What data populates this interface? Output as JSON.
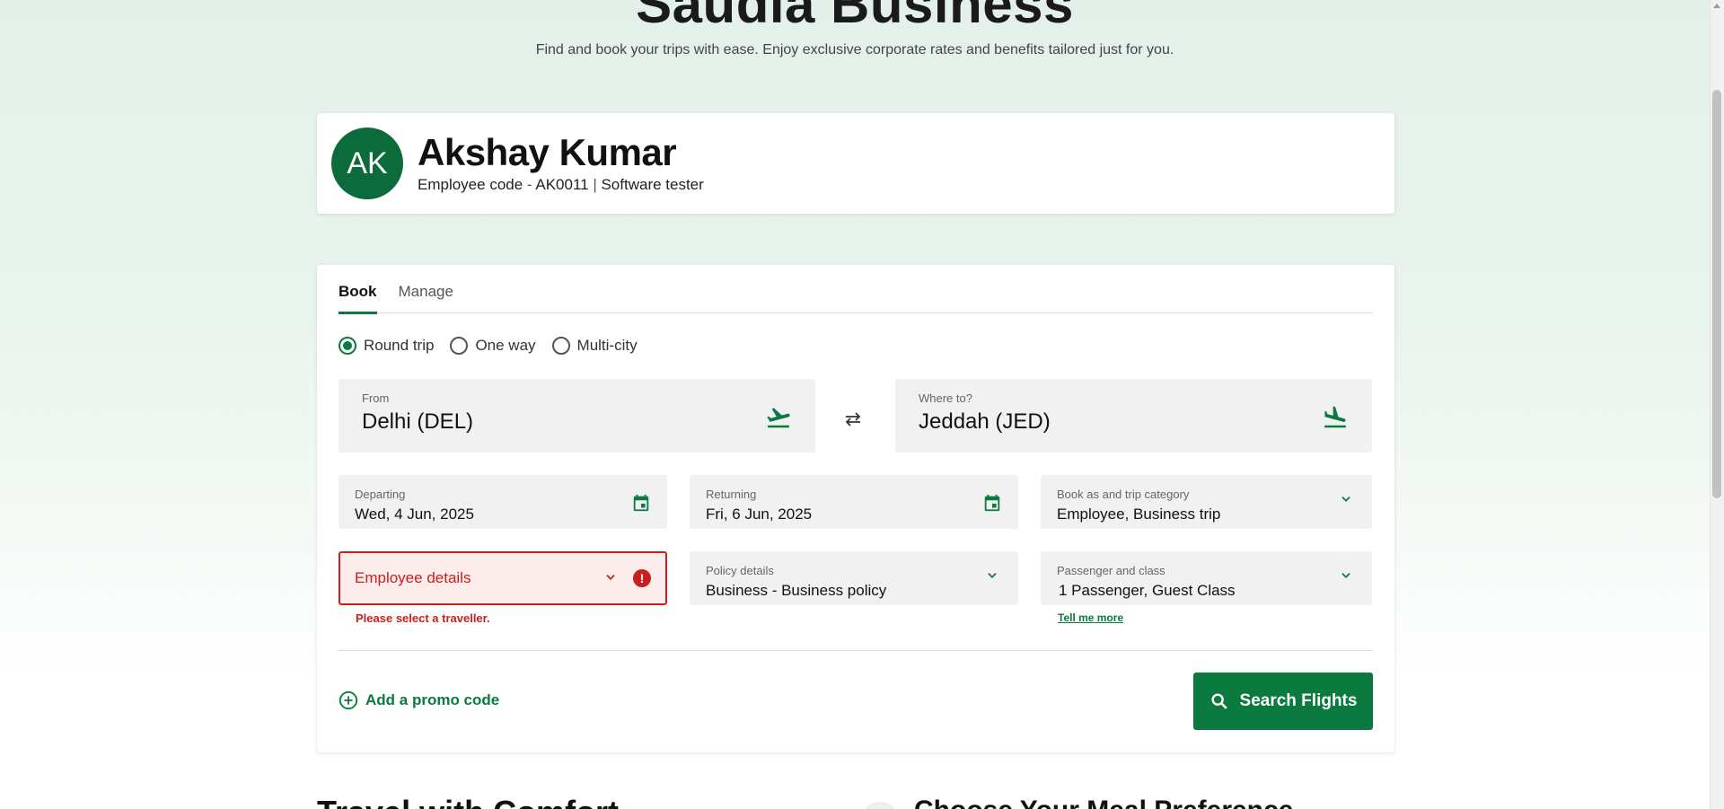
{
  "hero": {
    "title": "Saudia Business",
    "subtitle": "Find and book your trips with ease. Enjoy exclusive corporate rates and benefits tailored just for you."
  },
  "profile": {
    "initials": "AK",
    "name": "Akshay Kumar",
    "employee_code_label": "Employee code",
    "employee_code_sep": " - ",
    "employee_code": "AK0011",
    "divider": " | ",
    "role": "Software tester"
  },
  "tabs": [
    {
      "label": "Book",
      "active": true
    },
    {
      "label": "Manage",
      "active": false
    }
  ],
  "trip_types": [
    {
      "label": "Round trip",
      "selected": true
    },
    {
      "label": "One way",
      "selected": false
    },
    {
      "label": "Multi-city",
      "selected": false
    }
  ],
  "from": {
    "label": "From",
    "value": "Delhi (DEL)"
  },
  "to": {
    "label": "Where to?",
    "value": "Jeddah (JED)"
  },
  "departing": {
    "label": "Departing",
    "value": "Wed, 4 Jun, 2025"
  },
  "returning": {
    "label": "Returning",
    "value": "Fri, 6 Jun, 2025"
  },
  "book_as": {
    "label": "Book as and trip category",
    "value": "Employee, Business trip"
  },
  "employee_details": {
    "placeholder": "Employee details",
    "error_badge": "!",
    "error_message": "Please select a traveller."
  },
  "policy": {
    "label": "Policy details",
    "value": "Business - Business policy"
  },
  "passenger": {
    "label": "Passenger and class",
    "value": "1 Passenger, Guest Class",
    "link": "Tell me more"
  },
  "promo": {
    "label": "Add a promo code"
  },
  "search_button": {
    "label": "Search Flights"
  },
  "bottom": {
    "left_heading": "Travel with Comfort",
    "right_heading": "Choose Your Meal Preference"
  },
  "colors": {
    "brand_green": "#0b7a3e",
    "avatar_green": "#0b6b3a",
    "error_red": "#c8201d"
  }
}
